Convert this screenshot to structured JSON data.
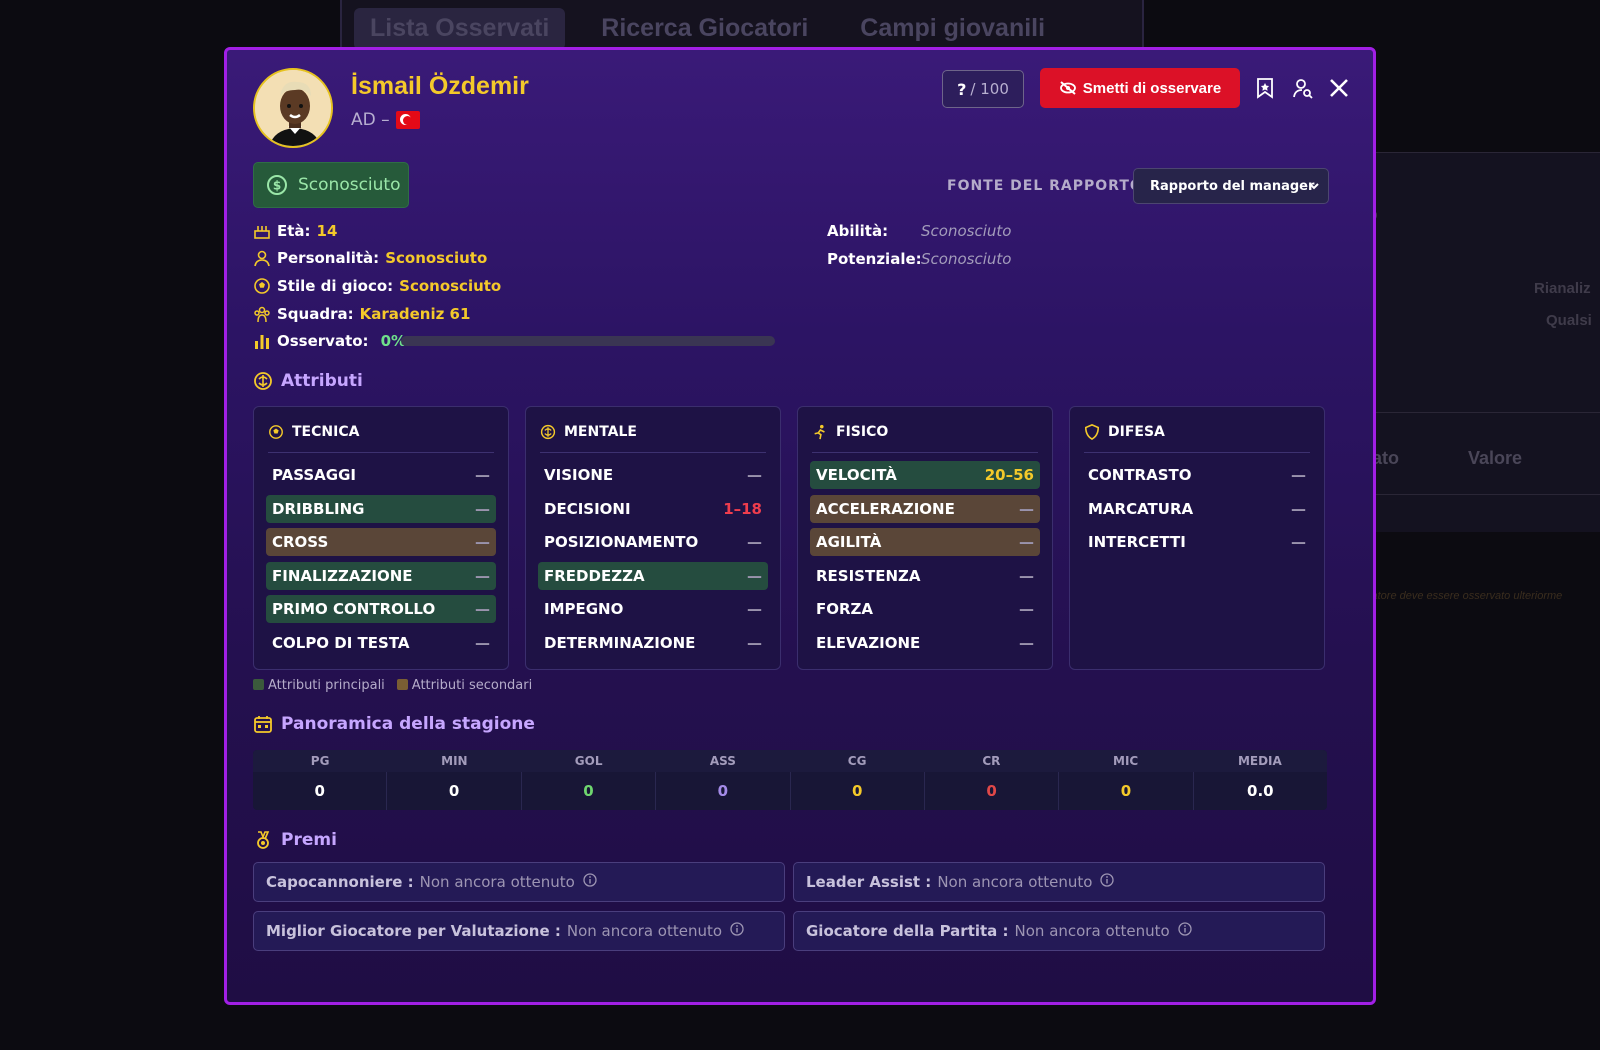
{
  "background": {
    "tabs": [
      "Lista Osservati",
      "Ricerca Giocatori",
      "Campi giovanili"
    ],
    "col_headers": [
      "vato",
      "Valore"
    ],
    "fragments": [
      "to",
      "si",
      "Rianaliz",
      "si",
      "Qualsi",
      "catore deve essere osservato ulteriorme"
    ]
  },
  "player": {
    "name": "İsmail Özdemir",
    "position": "AD –",
    "nationality_flag": "turkey-flag"
  },
  "header": {
    "score_question": "?",
    "score_max": "/ 100",
    "unwatch_label": "Smetti di osservare"
  },
  "value_badge": "Sconosciuto",
  "report_source": {
    "label": "FONTE DEL RAPPORTO",
    "selected": "Rapporto del manager"
  },
  "info": {
    "age_label": "Età:",
    "age": "14",
    "personality_label": "Personalità:",
    "personality": "Sconosciuto",
    "style_label": "Stile di gioco:",
    "style": "Sconosciuto",
    "team_label": "Squadra:",
    "team": "Karadeniz 61",
    "scouted_label": "Osservato:",
    "scouted": "0%",
    "scouted_fraction": 0
  },
  "abilities": {
    "ability_label": "Abilità:",
    "ability": "Sconosciuto",
    "potential_label": "Potenziale:",
    "potential": "Sconosciuto"
  },
  "attributes": {
    "title": "Attributi",
    "groups": [
      {
        "name": "TECNICA",
        "icon": "soccer-ball-icon",
        "items": [
          {
            "label": "PASSAGGI",
            "value": "—",
            "type": ""
          },
          {
            "label": "DRIBBLING",
            "value": "—",
            "type": "p"
          },
          {
            "label": "CROSS",
            "value": "—",
            "type": "s"
          },
          {
            "label": "FINALIZZAZIONE",
            "value": "—",
            "type": "p"
          },
          {
            "label": "PRIMO CONTROLLO",
            "value": "—",
            "type": "p"
          },
          {
            "label": "COLPO DI TESTA",
            "value": "—",
            "type": ""
          }
        ]
      },
      {
        "name": "MENTALE",
        "icon": "brain-icon",
        "items": [
          {
            "label": "VISIONE",
            "value": "—",
            "type": ""
          },
          {
            "label": "DECISIONI",
            "value": "1–18",
            "type": "",
            "color": "r"
          },
          {
            "label": "POSIZIONAMENTO",
            "value": "—",
            "type": ""
          },
          {
            "label": "FREDDEZZA",
            "value": "—",
            "type": "p"
          },
          {
            "label": "IMPEGNO",
            "value": "—",
            "type": ""
          },
          {
            "label": "DETERMINAZIONE",
            "value": "—",
            "type": ""
          }
        ]
      },
      {
        "name": "FISICO",
        "icon": "running-icon",
        "items": [
          {
            "label": "VELOCITÀ",
            "value": "20–56",
            "type": "p",
            "color": "y"
          },
          {
            "label": "ACCELERAZIONE",
            "value": "—",
            "type": "s"
          },
          {
            "label": "AGILITÀ",
            "value": "—",
            "type": "s"
          },
          {
            "label": "RESISTENZA",
            "value": "—",
            "type": ""
          },
          {
            "label": "FORZA",
            "value": "—",
            "type": ""
          },
          {
            "label": "ELEVAZIONE",
            "value": "—",
            "type": ""
          }
        ]
      },
      {
        "name": "DIFESA",
        "icon": "shield-icon",
        "items": [
          {
            "label": "CONTRASTO",
            "value": "—",
            "type": ""
          },
          {
            "label": "MARCATURA",
            "value": "—",
            "type": ""
          },
          {
            "label": "INTERCETTI",
            "value": "—",
            "type": ""
          }
        ]
      }
    ],
    "legend_primary": "Attributi principali",
    "legend_secondary": "Attributi secondari"
  },
  "season": {
    "title": "Panoramica della stagione",
    "columns": [
      {
        "label": "PG",
        "value": "0",
        "color": "#ffffff"
      },
      {
        "label": "MIN",
        "value": "0",
        "color": "#ffffff"
      },
      {
        "label": "GOL",
        "value": "0",
        "color": "#6fd66f"
      },
      {
        "label": "ASS",
        "value": "0",
        "color": "#a48be8"
      },
      {
        "label": "CG",
        "value": "0",
        "color": "#f4c92a"
      },
      {
        "label": "CR",
        "value": "0",
        "color": "#e04848"
      },
      {
        "label": "MIC",
        "value": "0",
        "color": "#f4c92a"
      },
      {
        "label": "MEDIA",
        "value": "0.0",
        "color": "#ffffff"
      }
    ]
  },
  "awards": {
    "title": "Premi",
    "items": [
      {
        "label": "Capocannoniere :",
        "value": "Non ancora ottenuto"
      },
      {
        "label": "Leader Assist :",
        "value": "Non ancora ottenuto"
      },
      {
        "label": "Miglior Giocatore per Valutazione :",
        "value": "Non ancora ottenuto"
      },
      {
        "label": "Giocatore della Partita :",
        "value": "Non ancora ottenuto"
      }
    ]
  },
  "colors": {
    "accent_yellow": "#f4c92a",
    "border_purple": "#a21fe6",
    "danger_red": "#dc1127",
    "primary_green": "#254c3f",
    "secondary_brown": "#5a4638"
  }
}
